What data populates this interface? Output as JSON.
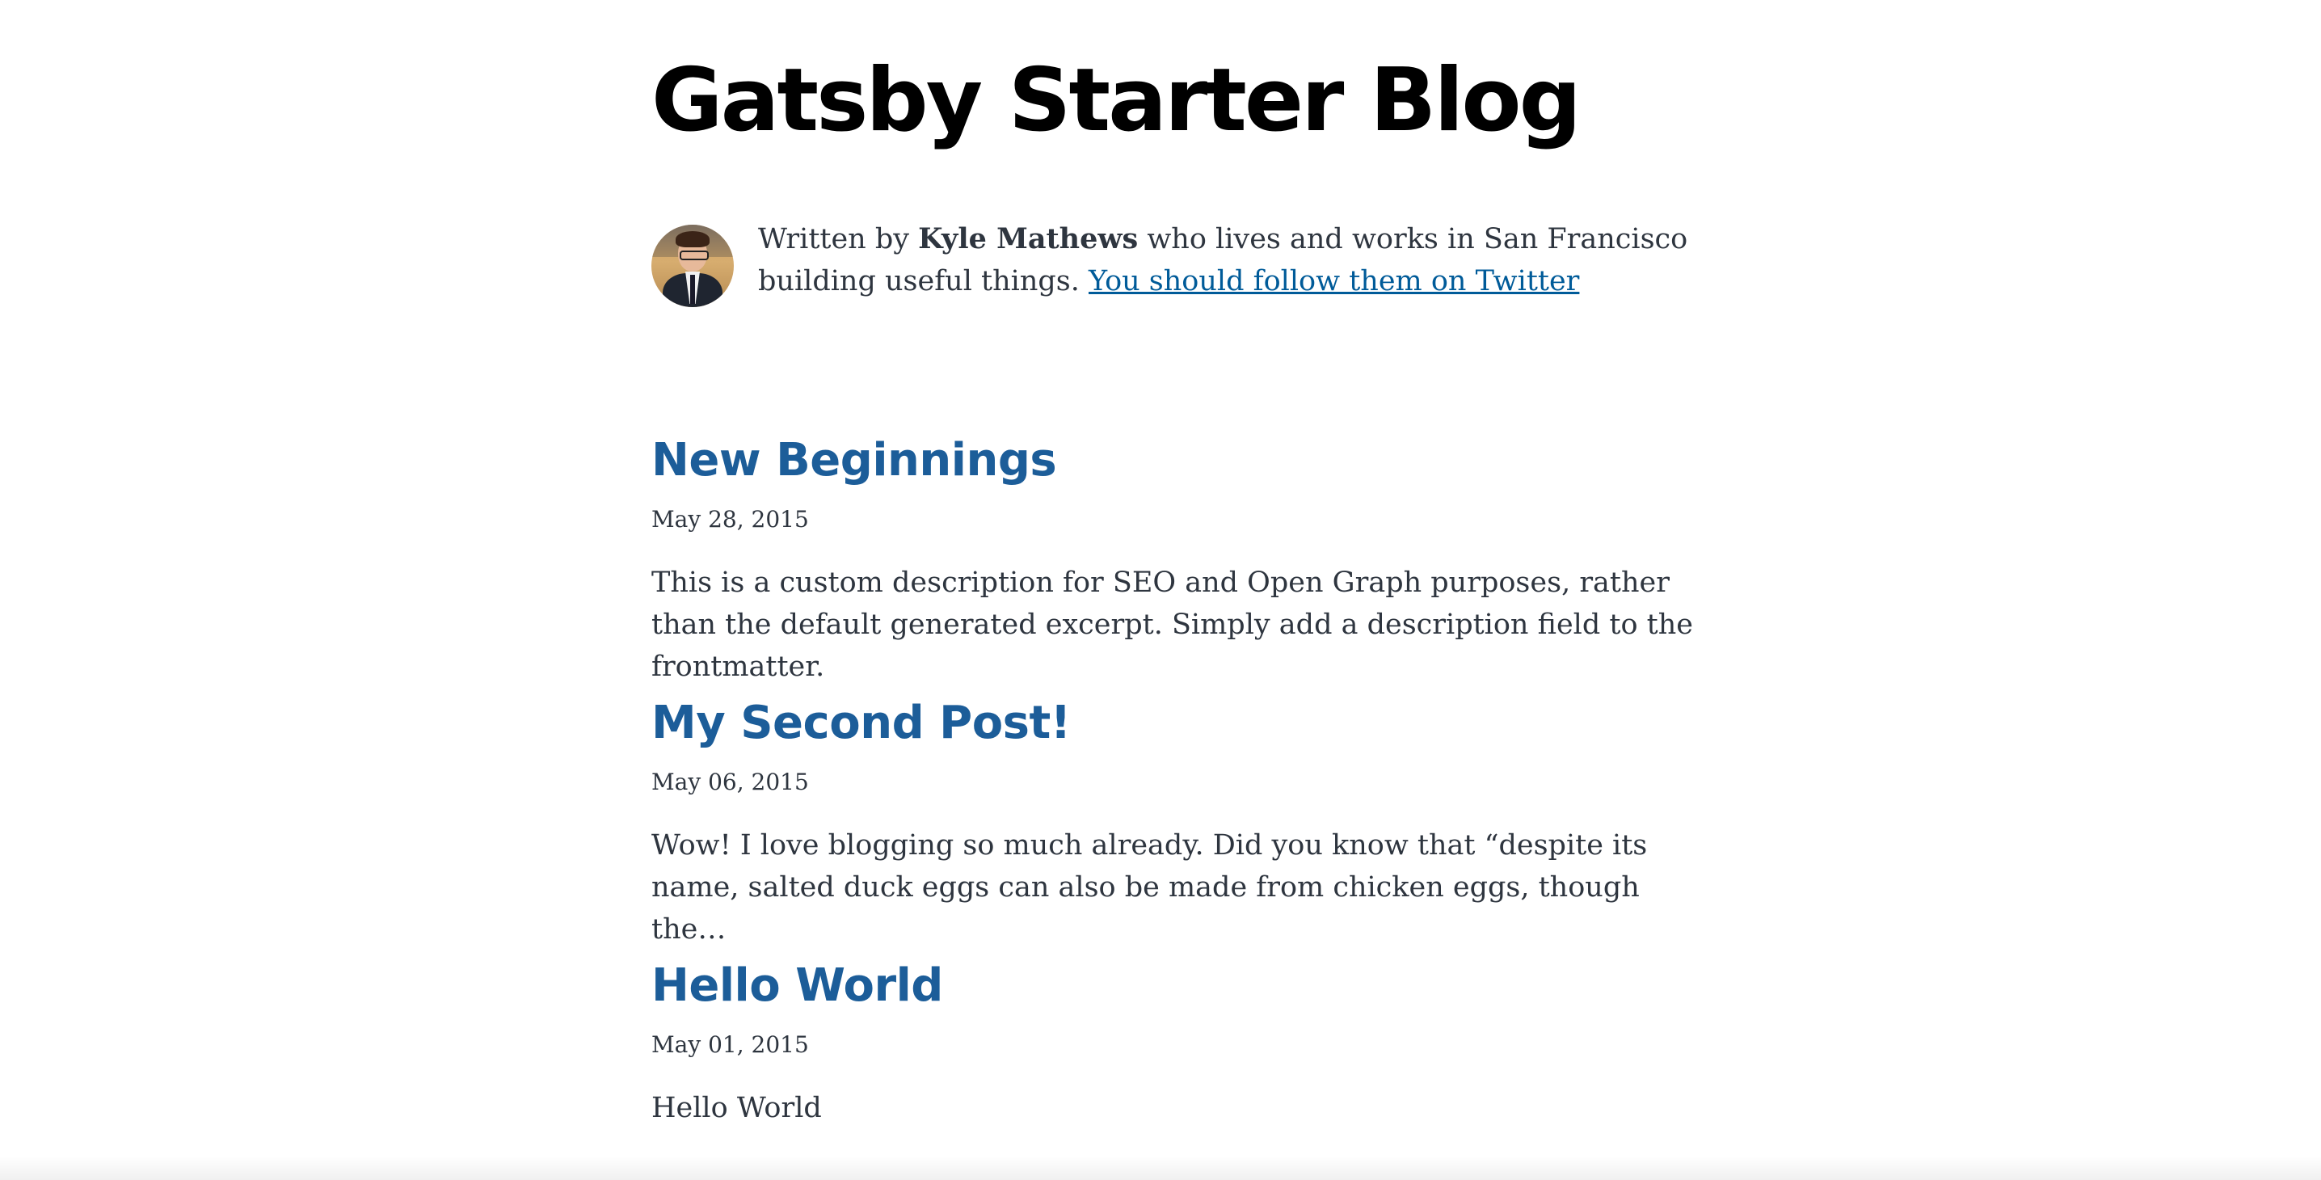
{
  "site": {
    "title": "Gatsby Starter Blog"
  },
  "bio": {
    "prefix": "Written by ",
    "author": "Kyle Mathews",
    "suffix": " who lives and works in San Francisco building useful things. ",
    "link_text": "You should follow them on Twitter"
  },
  "posts": [
    {
      "title": "New Beginnings",
      "date": "May 28, 2015",
      "description": "This is a custom description for SEO and Open Graph purposes, rather than the default generated excerpt. Simply add a description field to the frontmatter."
    },
    {
      "title": "My Second Post!",
      "date": "May 06, 2015",
      "description": "Wow! I love blogging so much already. Did you know that “despite its name, salted duck eggs can also be made from chicken eggs, though the…"
    },
    {
      "title": "Hello World",
      "date": "May 01, 2015",
      "description": "Hello World"
    }
  ],
  "colors": {
    "title": "#000000",
    "text": "#2e353f",
    "post_link": "#1c5d99",
    "bio_link": "#005b99",
    "background": "#ffffff"
  }
}
